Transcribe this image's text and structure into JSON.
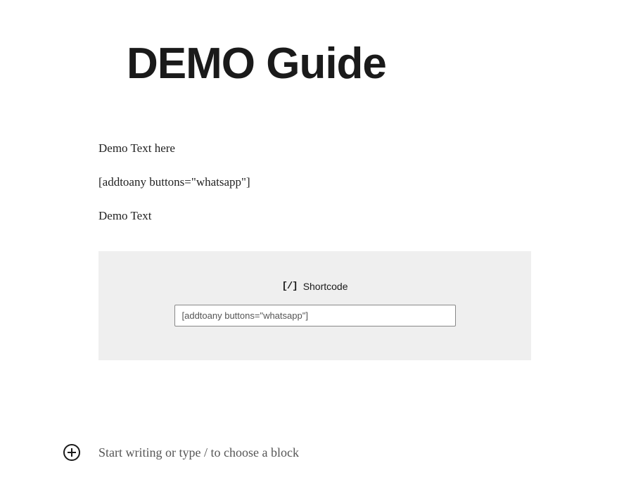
{
  "title": "DEMO Guide",
  "blocks": {
    "text1": "Demo Text here",
    "text2": " [addtoany buttons=\"whatsapp\"]",
    "text3": "Demo Text"
  },
  "shortcode": {
    "label": "Shortcode",
    "icon_text": "[/]",
    "value": "[addtoany buttons=\"whatsapp\"]"
  },
  "new_block": {
    "placeholder": "Start writing or type / to choose a block"
  }
}
